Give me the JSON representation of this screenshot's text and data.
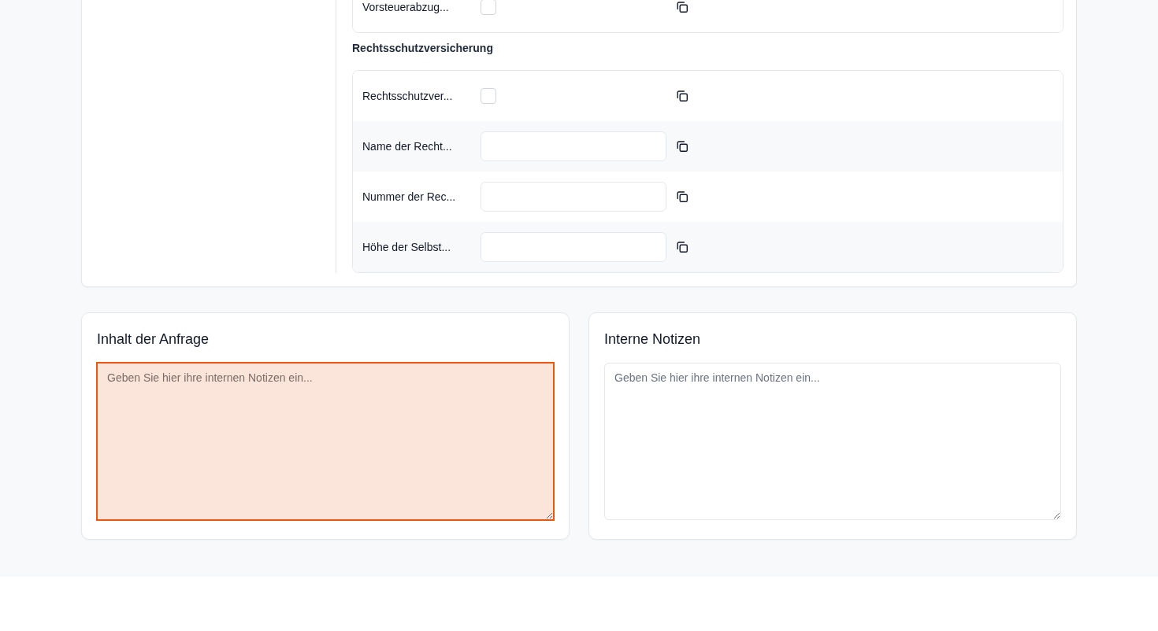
{
  "form": {
    "sections": [
      {
        "rows": [
          {
            "kind": "checkbox",
            "label": "Vorsteuerabzug...",
            "checked": false
          }
        ]
      },
      {
        "heading": "Rechtsschutzversicherung",
        "rows": [
          {
            "kind": "checkbox",
            "label": "Rechtsschutzver...",
            "checked": false
          },
          {
            "kind": "text",
            "label": "Name der Recht..."
          },
          {
            "kind": "text",
            "label": "Nummer der Rec..."
          },
          {
            "kind": "text",
            "label": "Höhe der Selbst..."
          }
        ]
      }
    ]
  },
  "panels": [
    {
      "title": "Inhalt der Anfrage",
      "placeholder": "Geben Sie hier ihre internen Notizen ein...",
      "highlighted": true
    },
    {
      "title": "Interne Notizen",
      "placeholder": "Geben Sie hier ihre internen Notizen ein...",
      "highlighted": false
    }
  ]
}
